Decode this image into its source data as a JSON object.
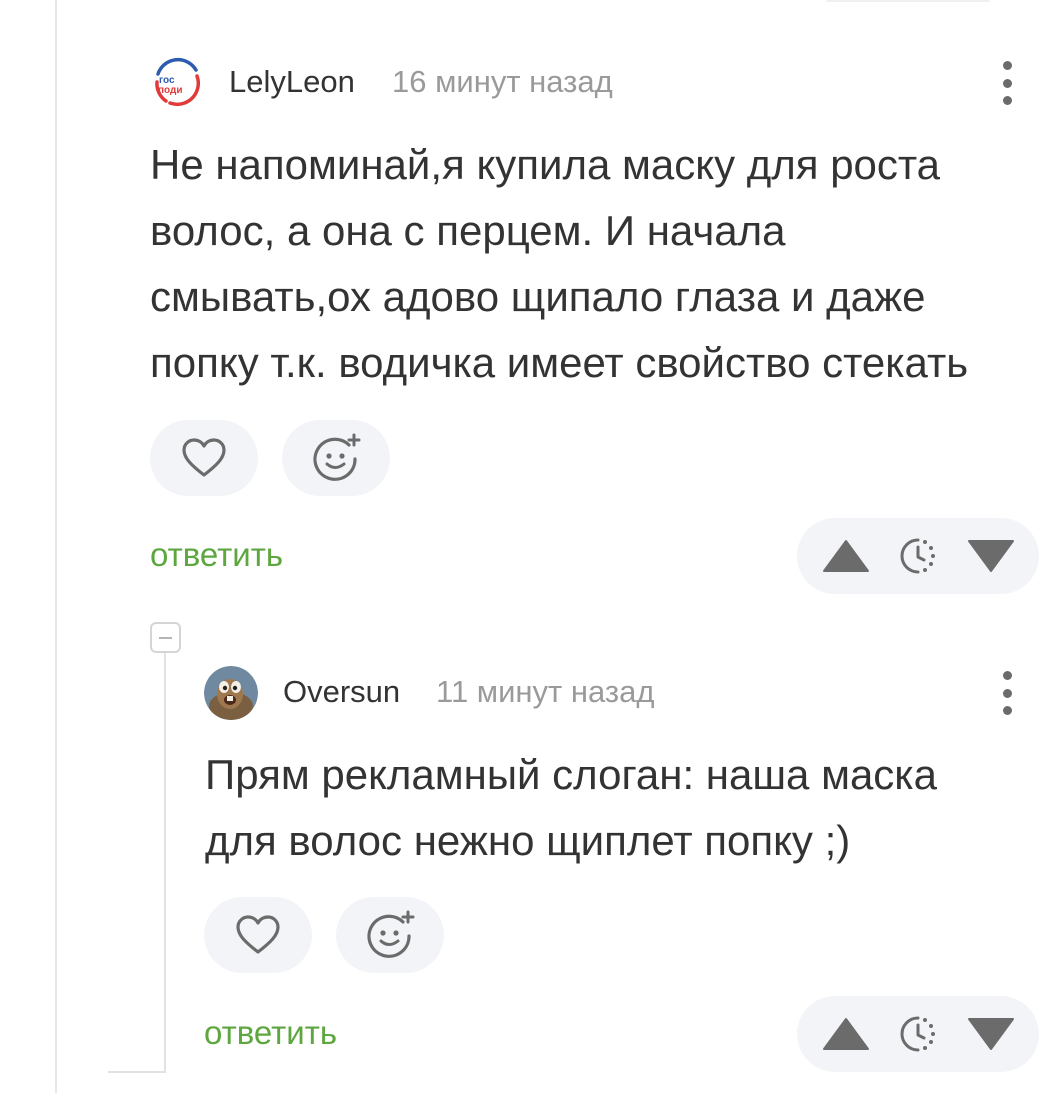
{
  "comments": [
    {
      "username": "LelyLeon",
      "time": "16 минут назад",
      "avatar": {
        "logo_text_top": "гос",
        "logo_text_bottom": "поди"
      },
      "text_lines": [
        "Не напоминай,я купила маску для роста",
        "волос, а она с перцем. И начала",
        "смывать,ох адово щипало глаза и даже",
        "попку т.к. водичка имеет свойство стекать"
      ],
      "reply_label": "ответить",
      "icons": {
        "like": "heart-icon",
        "reaction": "smiley-add-icon",
        "more": "kebab-menu-icon",
        "up": "triangle-up-icon",
        "time": "clock-dotted-icon",
        "down": "triangle-down-icon"
      }
    },
    {
      "username": "Oversun",
      "time": "11 минут назад",
      "text_lines": [
        "Прям рекламный слоган: наша маска",
        "для волос нежно щиплет попку ;)"
      ],
      "reply_label": "ответить",
      "icons": {
        "like": "heart-icon",
        "reaction": "smiley-add-icon",
        "more": "kebab-menu-icon",
        "up": "triangle-up-icon",
        "time": "clock-dotted-icon",
        "down": "triangle-down-icon"
      }
    }
  ],
  "colors": {
    "reply_green": "#5ea63f",
    "text": "#333333",
    "muted": "#9a9a9a",
    "button_bg": "#f3f4f7",
    "icon_gray": "#6b6b6b",
    "logo_blue": "#2c5bb0",
    "logo_red": "#e23a3a"
  }
}
